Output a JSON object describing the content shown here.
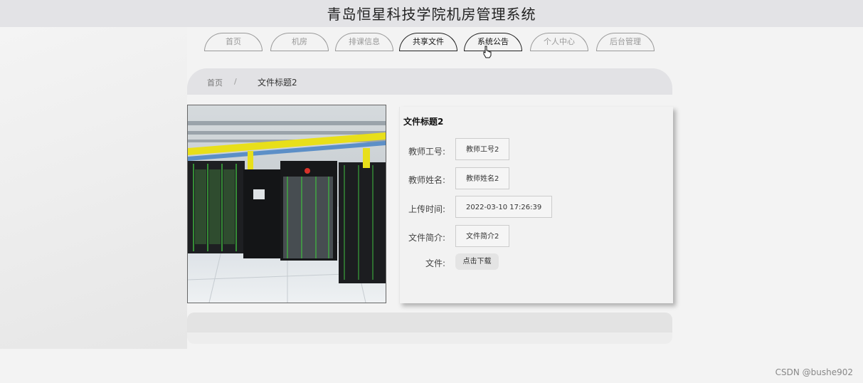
{
  "site_title": "青岛恒星科技学院机房管理系统",
  "nav": {
    "items": [
      "首页",
      "机房",
      "排课信息",
      "共享文件",
      "系统公告",
      "个人中心",
      "后台管理"
    ]
  },
  "breadcrumb": {
    "home": "首页",
    "separator": "/",
    "current": "文件标题2"
  },
  "detail": {
    "title": "文件标题2",
    "fields": [
      {
        "label": "教师工号:",
        "value": "教师工号2"
      },
      {
        "label": "教师姓名:",
        "value": "教师姓名2"
      },
      {
        "label": "上传时间:",
        "value": "2022-03-10 17:26:39"
      },
      {
        "label": "文件简介:",
        "value": "文件简介2"
      }
    ],
    "file_label": "文件:",
    "download_label": "点击下载"
  },
  "watermark": "CSDN @bushe902",
  "colors": {
    "header_bg": "#e3e3e6",
    "page_bg": "#f3f3f3",
    "rail_yellow": "#e8df1a",
    "rack_green": "#3fbf3f"
  },
  "icons": {
    "cursor": "hand-pointer-icon"
  }
}
